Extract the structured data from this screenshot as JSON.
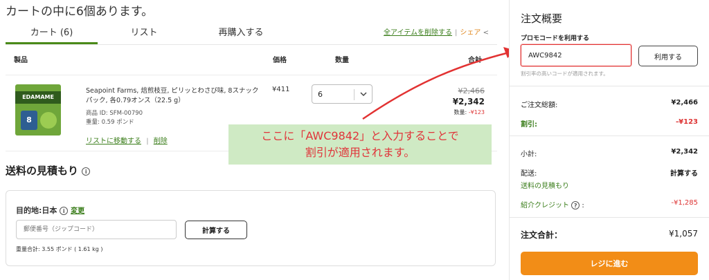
{
  "page": {
    "cart_title": "カートの中に6個あります。"
  },
  "tabs": [
    {
      "label": "カート (6)"
    },
    {
      "label": "リスト"
    },
    {
      "label": "再購入する"
    }
  ],
  "tab_actions": {
    "remove_all": "全アイテムを削除する",
    "share": "シェア",
    "share_icon": "<"
  },
  "table": {
    "headers": {
      "product": "製品",
      "price": "価格",
      "qty": "数量",
      "total": "合計"
    }
  },
  "item": {
    "image_band": "EDAMAME",
    "image_pack": "8",
    "name": "Seapoint Farms, 焙煎枝豆, ピリッとわさび味, 8スナックパック, 各0.79オンス（22.5 g）",
    "id": "商品 ID: SFM-00790",
    "weight": "重量: 0.59 ポンド",
    "move_to_list": "リストに移動する",
    "separator": "|",
    "delete": "削除",
    "price": "¥411",
    "qty": "6",
    "total_old": "¥2,466",
    "total_new": "¥2,342",
    "qty_label": "数量:",
    "discount": "-¥123"
  },
  "shipping": {
    "title": "送料の見積もり",
    "info_icon": "i",
    "dest_label": "目的地:日本",
    "change": "変更",
    "zip_placeholder": "郵便番号（ジップコード）",
    "calc_button": "計算する",
    "weight_total": "重量合計: 3.55 ポンド ( 1.61 kg )"
  },
  "callout": {
    "line1": "ここに「AWC9842」と入力することで",
    "line2": "割引が適用されます。"
  },
  "summary": {
    "title": "注文概要",
    "promo_label": "プロモコードを利用する",
    "promo_value": "AWC9842",
    "apply_button": "利用する",
    "promo_note": "割引率の高いコードが適用されます。",
    "order_total_label": "ご注文総額:",
    "order_total_value": "¥2,466",
    "discount_label": "割引:",
    "discount_value": "-¥123",
    "subtotal_label": "小計:",
    "subtotal_value": "¥2,342",
    "shipping_label": "配送:",
    "shipping_value": "計算する",
    "shipping_estimate_link": "送料の見積もり",
    "referral_label": "紹介クレジット",
    "referral_info": "?",
    "referral_colon": ":",
    "referral_value": "-¥1,285",
    "grand_total_label": "注文合計：",
    "grand_total_value": "¥1,057",
    "checkout_button": "レジに進む"
  },
  "colors": {
    "accent_green": "#3a7d1a",
    "checkout_orange": "#f28d17",
    "callout_bg": "#cfeac4",
    "annotation_red": "#e0343a"
  }
}
